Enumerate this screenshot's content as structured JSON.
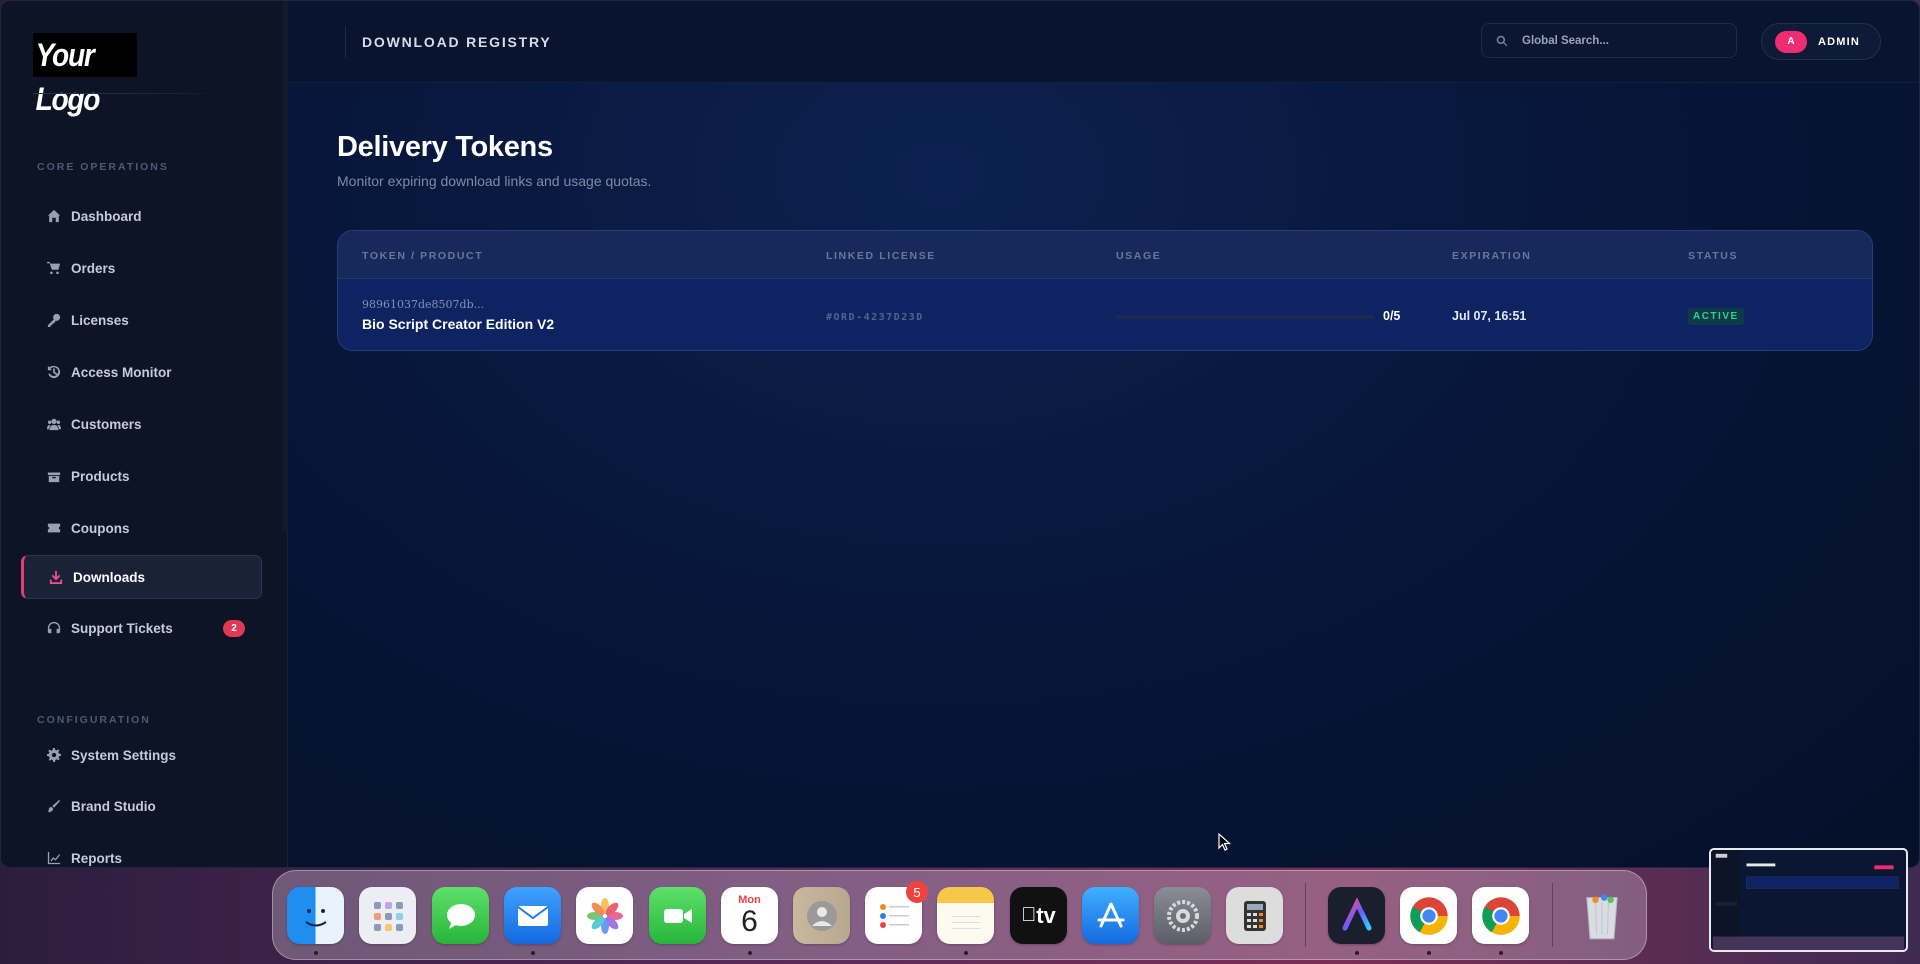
{
  "sidebar": {
    "logo": "Your Logo",
    "sections": {
      "core": "CORE OPERATIONS",
      "config": "CONFIGURATION"
    },
    "items": [
      {
        "label": "Dashboard",
        "icon": "home-icon"
      },
      {
        "label": "Orders",
        "icon": "cart-icon"
      },
      {
        "label": "Licenses",
        "icon": "key-icon"
      },
      {
        "label": "Access Monitor",
        "icon": "history-icon"
      },
      {
        "label": "Customers",
        "icon": "users-icon"
      },
      {
        "label": "Products",
        "icon": "box-icon"
      },
      {
        "label": "Coupons",
        "icon": "ticket-icon"
      },
      {
        "label": "Downloads",
        "icon": "download-icon",
        "active": true
      },
      {
        "label": "Support Tickets",
        "icon": "headset-icon",
        "badge": "2"
      }
    ],
    "config_items": [
      {
        "label": "System Settings",
        "icon": "gear-icon"
      },
      {
        "label": "Brand Studio",
        "icon": "brush-icon"
      },
      {
        "label": "Reports",
        "icon": "chart-icon"
      }
    ]
  },
  "topbar": {
    "title": "DOWNLOAD REGISTRY",
    "search_placeholder": "Global Search...",
    "avatar_initial": "A",
    "user_label": "ADMIN"
  },
  "main": {
    "title": "Delivery Tokens",
    "subtitle": "Monitor expiring download links and usage quotas.",
    "table": {
      "headers": [
        "TOKEN / PRODUCT",
        "LINKED LICENSE",
        "USAGE",
        "EXPIRATION",
        "STATUS"
      ],
      "rows": [
        {
          "token": "98961037de8507db...",
          "product": "Bio Script Creator Edition V2",
          "license": "#ORD-4237D23D",
          "usage_used": 0,
          "usage_total": 5,
          "usage_text": "0/5",
          "expiration": "Jul 07, 16:51",
          "status": "ACTIVE"
        }
      ]
    }
  },
  "dock": {
    "calendar_day": "Mon",
    "calendar_date": "6",
    "reminders_badge": "5",
    "appletv_label": "tv",
    "apps": [
      "finder",
      "launchpad",
      "messages",
      "mail",
      "photos",
      "facetime",
      "calendar",
      "contacts",
      "reminders",
      "notes",
      "apple-tv",
      "app-store",
      "system-settings",
      "calculator",
      "arc",
      "chrome",
      "chrome",
      "trash"
    ]
  },
  "colors": {
    "accent": "#ee2c72",
    "status_active": "#2ad58a",
    "sidebar_bg": "#0c1426",
    "main_bg": "#06132d"
  }
}
